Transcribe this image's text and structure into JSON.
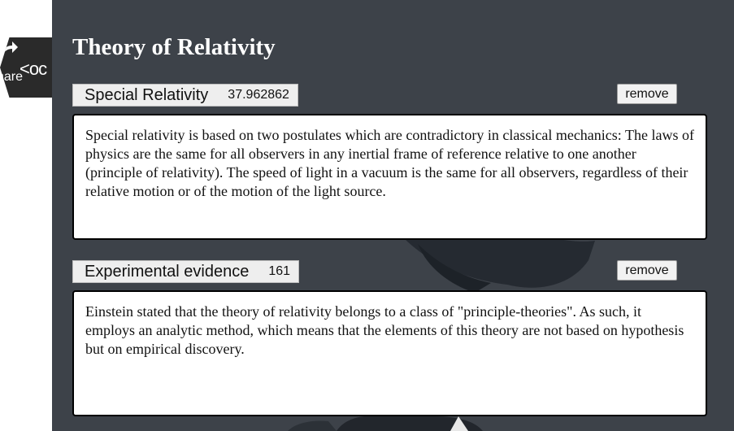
{
  "page": {
    "title": "Theory of Relativity"
  },
  "share_badge": {
    "share_text": "hare",
    "code_text": "<oc",
    "share_icon": "share-arrow-icon"
  },
  "sections": [
    {
      "title": "Special Relativity",
      "score": "37.962862",
      "remove_label": "remove",
      "body": "Special relativity is based on two postulates which are contradictory in classical mechanics: The laws of physics are the same for all observers in any inertial frame of reference relative to one another (principle of relativity). The speed of light in a vacuum is the same for all observers, regardless of their relative motion or of the motion of the light source."
    },
    {
      "title": "Experimental evidence",
      "score": "161",
      "remove_label": "remove",
      "body": "Einstein stated that the theory of relativity belongs to a class of \"principle-theories\". As such, it employs an analytic method, which means that the elements of this theory are not based on hypothesis but on empirical discovery."
    }
  ],
  "colors": {
    "background": "#3d4249",
    "panel": "#ffffff",
    "tab": "#eeeeee"
  }
}
